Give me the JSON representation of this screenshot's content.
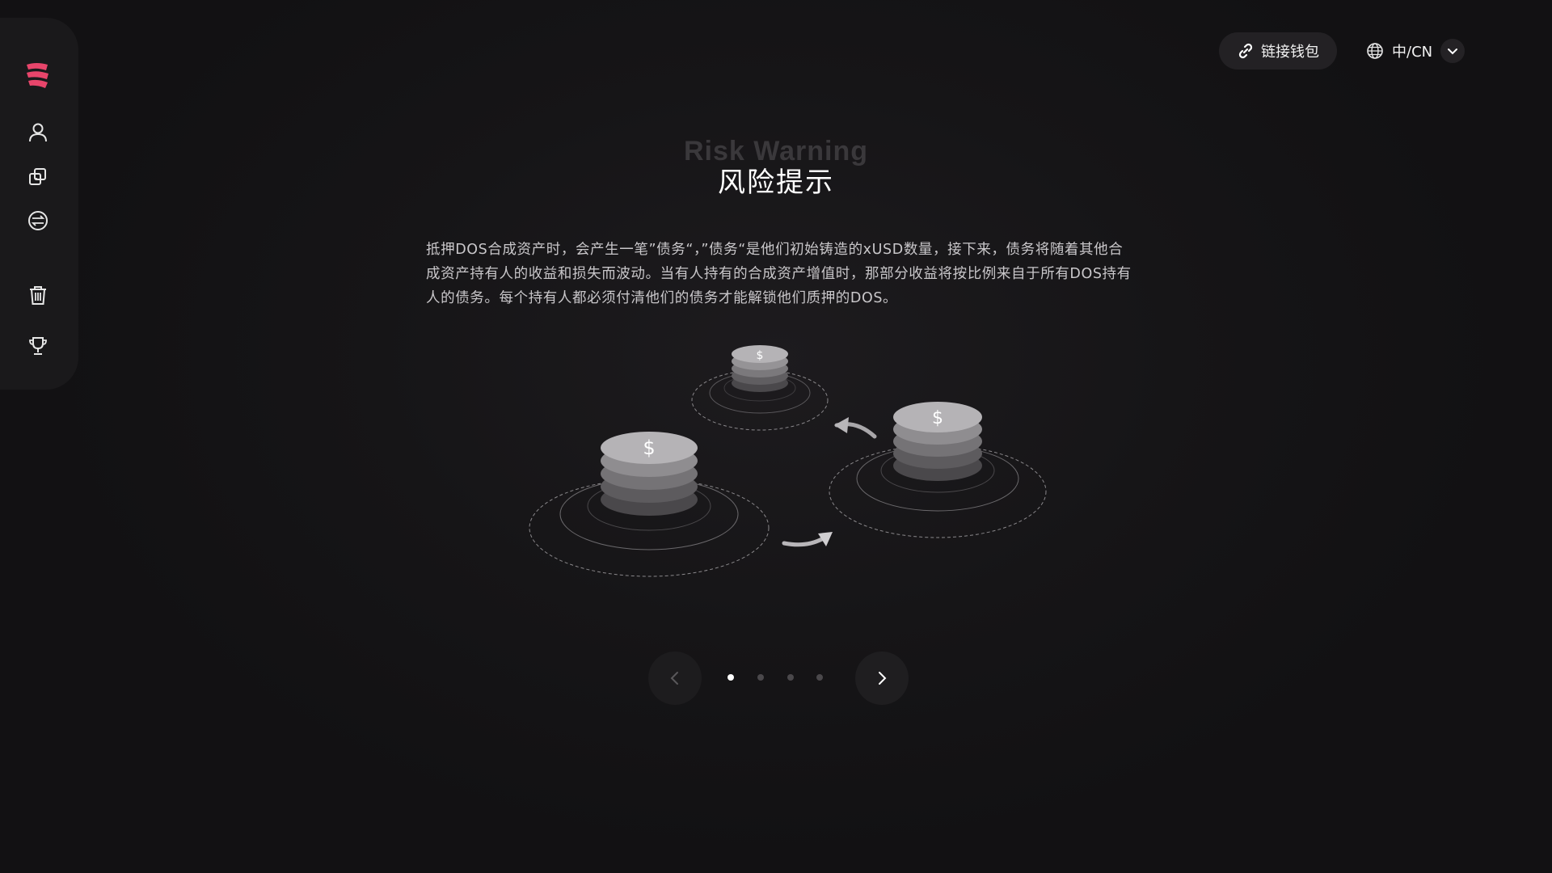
{
  "sidebar": {
    "logo": "brand-logo",
    "accent": "#e8456b",
    "items": [
      {
        "icon": "user-icon"
      },
      {
        "icon": "copy-icon"
      },
      {
        "icon": "swap-icon"
      },
      {
        "icon": "trash-icon"
      },
      {
        "icon": "trophy-icon"
      }
    ]
  },
  "header": {
    "wallet_label": "链接钱包",
    "wallet_icon": "link-icon",
    "language_label": "中/CN",
    "language_icon": "globe-icon"
  },
  "main": {
    "title_en": "Risk Warning",
    "title_cn": "风险提示",
    "description": "抵押DOS合成资产时，会产生一笔”债务“，”债务“是他们初始铸造的xUSD数量，接下来，债务将随着其他合成资产持有人的收益和损失而波动。当有人持有的合成资产增值时，那部分收益将按比例来自于所有DOS持有人的债务。每个持有人都必须付清他们的债务才能解锁他们质押的DOS。",
    "illustration": {
      "coin_symbol": "$"
    }
  },
  "carousel": {
    "current_index": 0,
    "total": 4,
    "prev_icon": "chevron-left-icon",
    "next_icon": "chevron-right-icon"
  }
}
